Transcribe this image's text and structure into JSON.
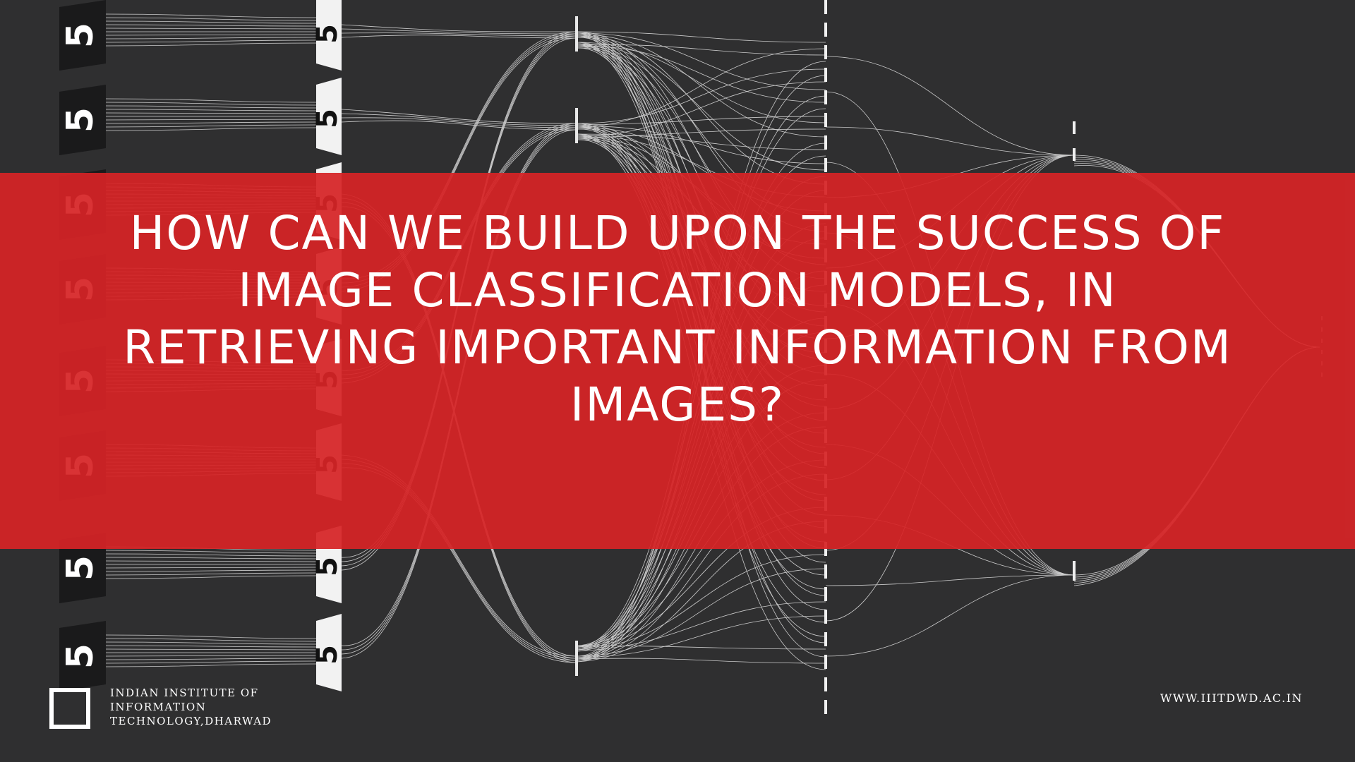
{
  "slide": {
    "headline": "HOW CAN WE BUILD UPON THE SUCCESS OF IMAGE CLASSIFICATION MODELS, IN RETRIEVING IMPORTANT INFORMATION FROM IMAGES?",
    "background_color": "#2f2f30",
    "band_color": "#d62426",
    "digit_glyph": "5"
  },
  "footer": {
    "logo_icon": "square-outline-icon",
    "institute_lines": [
      "INDIAN INSTITUTE OF",
      "INFORMATION",
      "TECHNOLOGY,DHARWAD"
    ],
    "website": "WWW.IIITDWD.AC.IN"
  }
}
